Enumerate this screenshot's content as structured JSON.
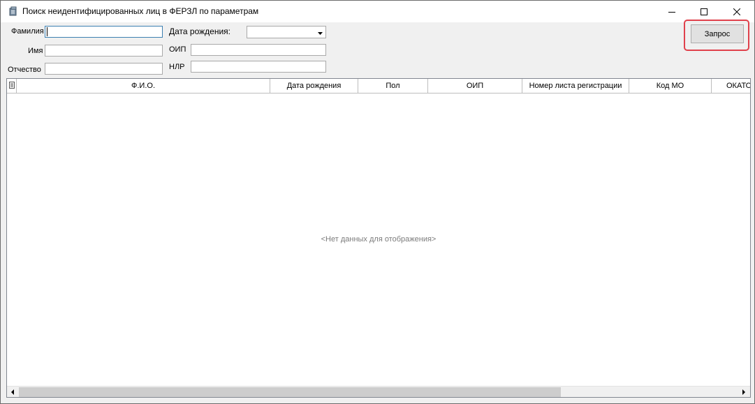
{
  "window": {
    "title": "Поиск неидентифицированных лиц в ФЕРЗЛ по параметрам",
    "controls": [
      "minimize-icon",
      "maximize-icon",
      "close-icon"
    ]
  },
  "form": {
    "surname": {
      "label": "Фамилия",
      "value": ""
    },
    "name": {
      "label": "Имя",
      "value": ""
    },
    "patronymic": {
      "label": "Отчество",
      "value": ""
    },
    "birth_date": {
      "label": "Дата рождения:",
      "value": ""
    },
    "oip": {
      "label": "ОИП",
      "value": ""
    },
    "nlr": {
      "label": "НЛР",
      "value": ""
    },
    "query_button": "Запрос"
  },
  "grid": {
    "columns": [
      "Ф.И.О.",
      "Дата рождения",
      "Пол",
      "ОИП",
      "Номер листа регистрации",
      "Код МО",
      "ОКАТО"
    ],
    "rows": [],
    "empty_text": "<Нет данных для отображения>"
  },
  "colors": {
    "highlight": "#e0414c",
    "window_bg": "#f0f0f0",
    "focus_border": "#3c7fb1"
  }
}
